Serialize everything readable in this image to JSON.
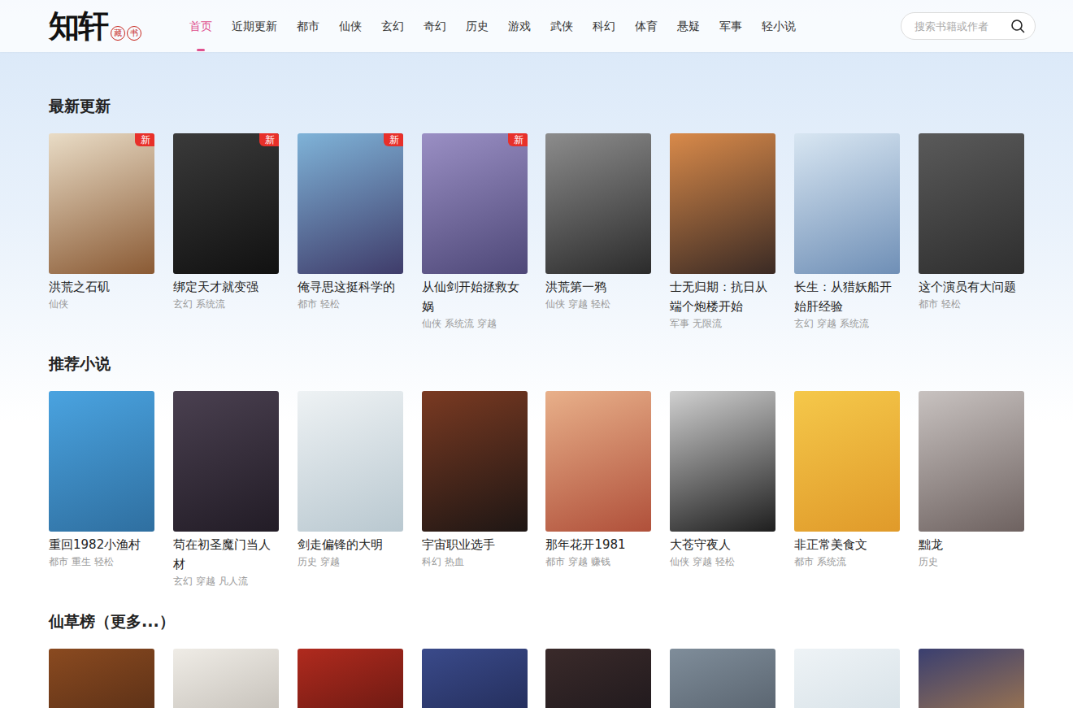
{
  "logo": {
    "main": "知轩",
    "seal": [
      "藏",
      "书"
    ]
  },
  "nav": [
    {
      "label": "首页",
      "selected": true
    },
    {
      "label": "近期更新",
      "selected": false
    },
    {
      "label": "都市",
      "selected": false
    },
    {
      "label": "仙侠",
      "selected": false
    },
    {
      "label": "玄幻",
      "selected": false
    },
    {
      "label": "奇幻",
      "selected": false
    },
    {
      "label": "历史",
      "selected": false
    },
    {
      "label": "游戏",
      "selected": false
    },
    {
      "label": "武侠",
      "selected": false
    },
    {
      "label": "科幻",
      "selected": false
    },
    {
      "label": "体育",
      "selected": false
    },
    {
      "label": "悬疑",
      "selected": false
    },
    {
      "label": "军事",
      "selected": false
    },
    {
      "label": "轻小说",
      "selected": false
    }
  ],
  "search": {
    "placeholder": "搜索书籍或作者"
  },
  "new_badge": "新",
  "sections": [
    {
      "title": "最新更新",
      "books": [
        {
          "title": "洪荒之石矶",
          "tags": [
            "仙侠"
          ],
          "is_new": true
        },
        {
          "title": "绑定天才就变强",
          "tags": [
            "玄幻",
            "系统流"
          ],
          "is_new": true
        },
        {
          "title": "俺寻思这挺科学的",
          "tags": [
            "都市",
            "轻松"
          ],
          "is_new": true
        },
        {
          "title": "从仙剑开始拯救女娲",
          "tags": [
            "仙侠",
            "系统流",
            "穿越"
          ],
          "is_new": true
        },
        {
          "title": "洪荒第一鸦",
          "tags": [
            "仙侠",
            "穿越",
            "轻松"
          ],
          "is_new": false
        },
        {
          "title": "士无归期：抗日从端个炮楼开始",
          "tags": [
            "军事",
            "无限流"
          ],
          "is_new": false
        },
        {
          "title": "长生：从猎妖船开始肝经验",
          "tags": [
            "玄幻",
            "穿越",
            "系统流"
          ],
          "is_new": false
        },
        {
          "title": "这个演员有大问题",
          "tags": [
            "都市",
            "轻松"
          ],
          "is_new": false
        }
      ]
    },
    {
      "title": "推荐小说",
      "books": [
        {
          "title": "重回1982小渔村",
          "tags": [
            "都市",
            "重生",
            "轻松"
          ],
          "is_new": false
        },
        {
          "title": "苟在初圣魔门当人材",
          "tags": [
            "玄幻",
            "穿越",
            "凡人流"
          ],
          "is_new": false
        },
        {
          "title": "剑走偏锋的大明",
          "tags": [
            "历史",
            "穿越"
          ],
          "is_new": false
        },
        {
          "title": "宇宙职业选手",
          "tags": [
            "科幻",
            "热血"
          ],
          "is_new": false
        },
        {
          "title": "那年花开1981",
          "tags": [
            "都市",
            "穿越",
            "赚钱"
          ],
          "is_new": false
        },
        {
          "title": "大苍守夜人",
          "tags": [
            "仙侠",
            "穿越",
            "轻松"
          ],
          "is_new": false
        },
        {
          "title": "非正常美食文",
          "tags": [
            "都市",
            "系统流"
          ],
          "is_new": false
        },
        {
          "title": "黜龙",
          "tags": [
            "历史"
          ],
          "is_new": false
        }
      ]
    },
    {
      "title": "仙草榜（更多...）",
      "books": [
        {
          "title": "",
          "tags": [],
          "is_new": false
        },
        {
          "title": "",
          "tags": [],
          "is_new": false
        },
        {
          "title": "",
          "tags": [],
          "is_new": false
        },
        {
          "title": "",
          "tags": [],
          "is_new": false
        },
        {
          "title": "",
          "tags": [],
          "is_new": false
        },
        {
          "title": "",
          "tags": [],
          "is_new": false
        },
        {
          "title": "",
          "tags": [],
          "is_new": false
        },
        {
          "title": "",
          "tags": [],
          "is_new": false
        }
      ]
    }
  ]
}
